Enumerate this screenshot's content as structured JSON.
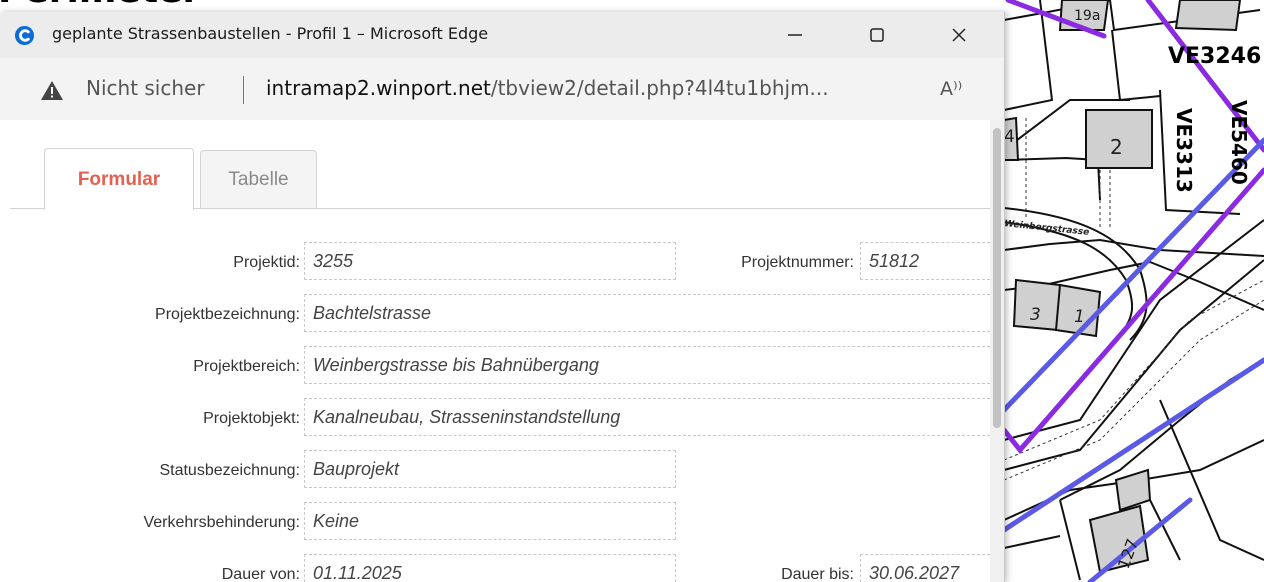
{
  "background_title_fragment": "Perimeter",
  "window": {
    "title": "geplante Strassenbaustellen - Profil 1 – Microsoft Edge",
    "minimize_icon": "minimize-icon",
    "maximize_icon": "maximize-icon",
    "close_icon": "close-icon"
  },
  "addressbar": {
    "security_label": "Nicht sicher",
    "url_host": "intramap2.winport.net",
    "url_path": "/tbview2/detail.php?4l4tu1bhjm...",
    "read_aloud_label": "A⁾⁾"
  },
  "tabs": [
    {
      "label": "Formular",
      "active": true
    },
    {
      "label": "Tabelle",
      "active": false
    }
  ],
  "form": {
    "projektid": {
      "label": "Projektid:",
      "value": "3255"
    },
    "projektnummer": {
      "label": "Projektnummer:",
      "value": "51812"
    },
    "projektbezeichnung": {
      "label": "Projektbezeichnung:",
      "value": "Bachtelstrasse"
    },
    "projektbereich": {
      "label": "Projektbereich:",
      "value": "Weinbergstrasse bis Bahnübergang"
    },
    "projektobjekt": {
      "label": "Projektobjekt:",
      "value": "Kanalneubau, Strasseninstandstellung"
    },
    "statusbezeichnung": {
      "label": "Statusbezeichnung:",
      "value": "Bauprojekt"
    },
    "verkehrsbehinderung": {
      "label": "Verkehrsbehinderung:",
      "value": "Keine"
    },
    "dauer_von": {
      "label": "Dauer von:",
      "value": "01.11.2025"
    },
    "dauer_bis": {
      "label": "Dauer bis:",
      "value": "30.06.2027"
    }
  },
  "map": {
    "labels": {
      "ve3246": "VE3246",
      "ve3313": "VE3313",
      "ve5460": "VE5460",
      "street": "Weinbergstrasse",
      "bld_2": "2",
      "bld_3": "3",
      "bld_1": "1",
      "bld_4": "4",
      "bld_127": "127",
      "bld_19a": "19a"
    },
    "colors": {
      "purple": "#8a2be2",
      "blue": "#5a5ae6",
      "building": "#d0d0d0"
    }
  },
  "colors": {
    "accent_tab": "#e5604e",
    "edge_blue": "#0a6cd6",
    "titlebar": "#ececec"
  }
}
